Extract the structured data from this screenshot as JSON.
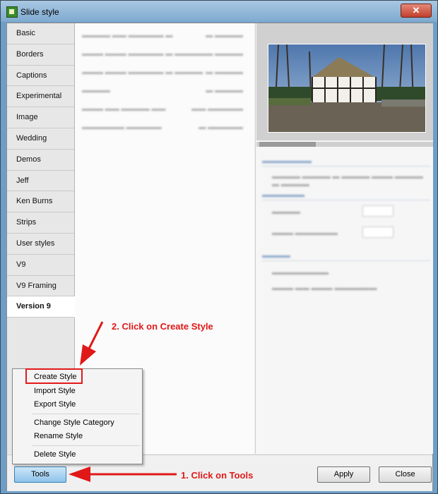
{
  "window": {
    "title": "Slide style",
    "close_glyph": "✕"
  },
  "sidebar": {
    "items": [
      {
        "label": "Basic"
      },
      {
        "label": "Borders"
      },
      {
        "label": "Captions"
      },
      {
        "label": "Experimental"
      },
      {
        "label": "Image"
      },
      {
        "label": "Wedding"
      },
      {
        "label": "Demos"
      },
      {
        "label": "Jeff"
      },
      {
        "label": "Ken Burns"
      },
      {
        "label": "Strips"
      },
      {
        "label": "User styles"
      },
      {
        "label": "V9"
      },
      {
        "label": "V9 Framing"
      },
      {
        "label": "Version 9"
      }
    ],
    "active_index": 13
  },
  "context_menu": {
    "items": [
      "Create Style",
      "Import Style",
      "Export Style",
      "Change Style Category",
      "Rename Style",
      "Delete Style"
    ]
  },
  "buttons": {
    "tools": "Tools",
    "apply": "Apply",
    "close": "Close"
  },
  "annotations": {
    "step1": "1. Click on Tools",
    "step2": "2. Click on Create Style",
    "color": "#e01818"
  },
  "icons": {
    "app": "slide-style-app-icon",
    "close": "close-icon"
  }
}
